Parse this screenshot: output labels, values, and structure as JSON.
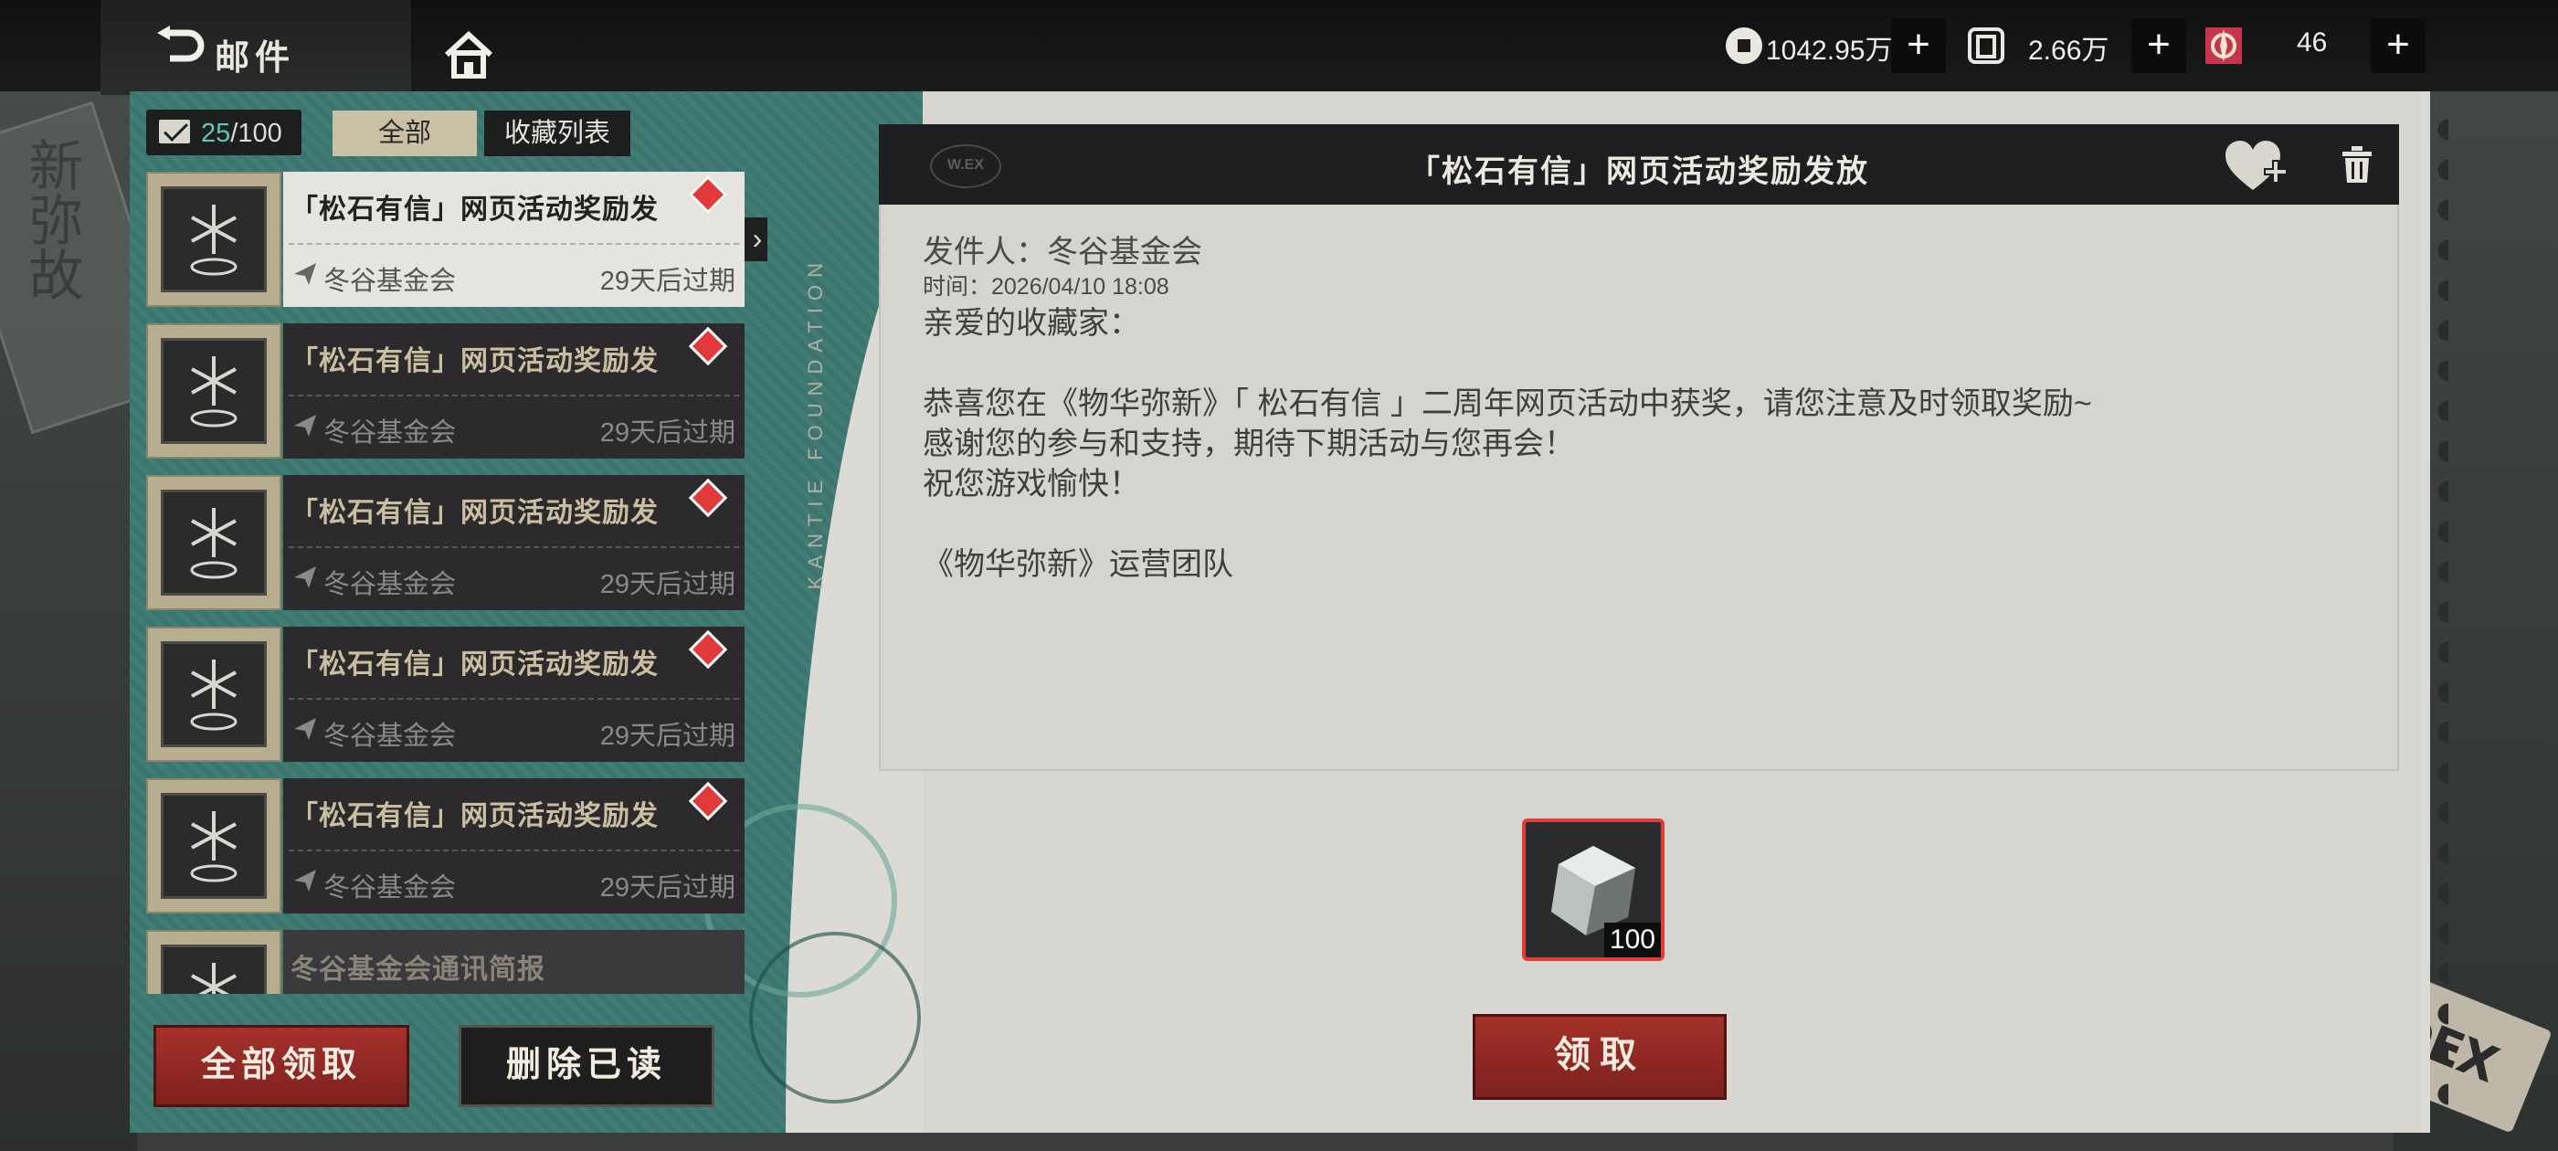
{
  "header": {
    "title": "邮件",
    "resources": [
      {
        "icon": "coin-icon",
        "value": "1042.95万"
      },
      {
        "icon": "ticket-icon",
        "value": "2.66万"
      },
      {
        "icon": "crystal-icon",
        "value": "46"
      }
    ]
  },
  "mailbox": {
    "count_current": "25",
    "count_total": "/100",
    "filters": {
      "all": "全部",
      "favorites": "收藏列表"
    }
  },
  "mail_list": [
    {
      "subject": "「松石有信」网页活动奖励发",
      "sender": "冬谷基金会",
      "expire": "29天后过期",
      "active": true
    },
    {
      "subject": "「松石有信」网页活动奖励发",
      "sender": "冬谷基金会",
      "expire": "29天后过期",
      "active": false
    },
    {
      "subject": "「松石有信」网页活动奖励发",
      "sender": "冬谷基金会",
      "expire": "29天后过期",
      "active": false
    },
    {
      "subject": "「松石有信」网页活动奖励发",
      "sender": "冬谷基金会",
      "expire": "29天后过期",
      "active": false
    },
    {
      "subject": "「松石有信」网页活动奖励发",
      "sender": "冬谷基金会",
      "expire": "29天后过期",
      "active": false
    },
    {
      "subject": "冬谷基金会通讯简报",
      "sender": "",
      "expire": "",
      "active": false
    }
  ],
  "actions": {
    "claim_all": "全部领取",
    "delete_read": "删除已读"
  },
  "detail": {
    "title": "「松石有信」网页活动奖励发放",
    "stamp": "W.EX",
    "from": "发件人：冬谷基金会",
    "time": "时间：2026/04/10  18:08",
    "lines": [
      "亲爱的收藏家：",
      "",
      "恭喜您在《物华弥新》「 松石有信 」二周年网页活动中获奖，请您注意及时领取奖励~",
      "感谢您的参与和支持，期待下期活动与您再会！",
      "祝您游戏愉快！",
      "",
      "《物华弥新》运营团队"
    ],
    "reward_qty": "100",
    "claim_button": "领取"
  },
  "decor": {
    "foundation_text": "KANTIE FOUNDATION",
    "bg_left_text": "新弥故",
    "corner_logo": "WDEX"
  },
  "colors": {
    "accent_red": "#a5302a",
    "teal_panel": "#3e7a72",
    "badge_red": "#e23a3a",
    "count_teal": "#5ec6bd"
  }
}
